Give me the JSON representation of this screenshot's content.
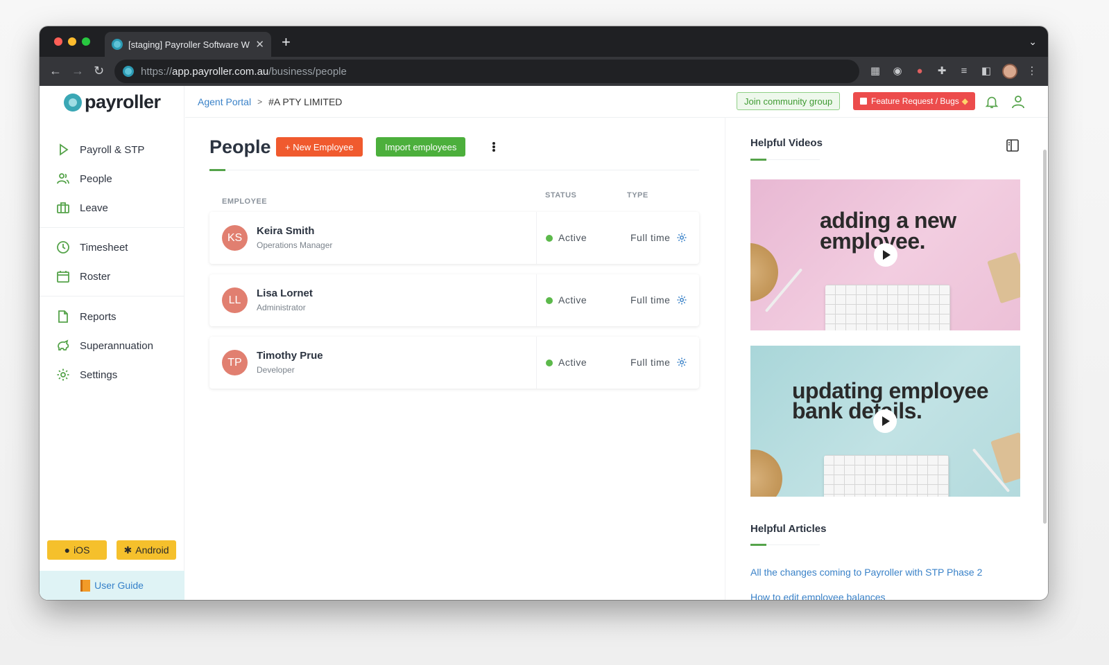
{
  "browser": {
    "tab_title": "[staging] Payroller Software W",
    "new_tab": "+",
    "url_scheme": "https://",
    "url_host": "app.payroller.com.au",
    "url_path": "/business/people"
  },
  "sidebar": {
    "logo_text": "payroller",
    "nav": {
      "payroll": "Payroll & STP",
      "people": "People",
      "leave": "Leave",
      "timesheet": "Timesheet",
      "roster": "Roster",
      "reports": "Reports",
      "super": "Superannuation",
      "settings": "Settings"
    },
    "ios_label": "iOS",
    "android_label": "Android",
    "user_guide": "User Guide"
  },
  "topbar": {
    "breadcrumb_link": "Agent Portal",
    "breadcrumb_separator": ">",
    "breadcrumb_current": "#A PTY LIMITED",
    "community_btn": "Join community group",
    "feature_btn": "Feature Request / Bugs"
  },
  "main": {
    "title": "People",
    "new_employee": "+ New Employee",
    "import_employees": "Import employees",
    "columns": {
      "employee": "EMPLOYEE",
      "status": "STATUS",
      "type": "TYPE"
    },
    "employees": [
      {
        "initials": "KS",
        "name": "Keira Smith",
        "role": "Operations Manager",
        "status": "Active",
        "type": "Full time"
      },
      {
        "initials": "LL",
        "name": "Lisa Lornet",
        "role": "Administrator",
        "status": "Active",
        "type": "Full time"
      },
      {
        "initials": "TP",
        "name": "Timothy Prue",
        "role": "Developer",
        "status": "Active",
        "type": "Full time"
      }
    ]
  },
  "right_panel": {
    "videos_heading": "Helpful Videos",
    "videos": [
      {
        "line1": "adding a new",
        "line2": "employee."
      },
      {
        "line1": "updating employee",
        "line2": "bank details."
      }
    ],
    "articles_heading": "Helpful Articles",
    "articles": [
      "All the changes coming to Payroller with STP Phase 2",
      "How to edit employee balances"
    ]
  },
  "colors": {
    "accent_green": "#55a34a",
    "new_employee_orange": "#f05a2e",
    "import_green": "#4caf3c",
    "feature_red": "#ec4c4c",
    "avatar": "#e17f70",
    "link_blue": "#3a82c8"
  }
}
